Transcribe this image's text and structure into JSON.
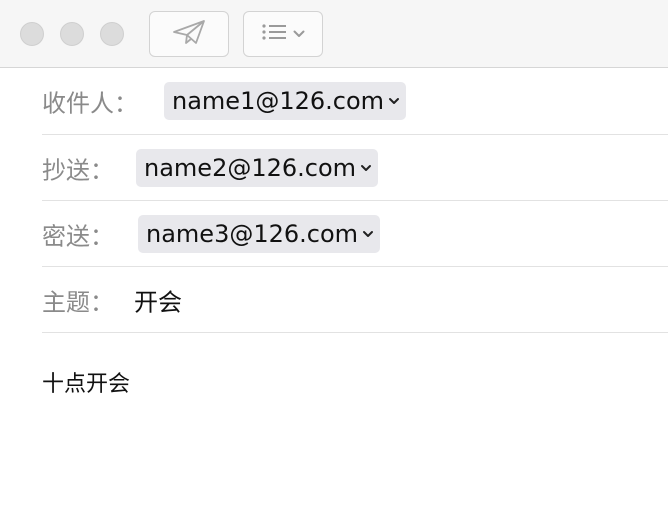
{
  "toolbar": {
    "window_controls": [
      "close",
      "minimize",
      "zoom"
    ],
    "send_icon": "paper-plane-icon",
    "format_icon": "list-icon",
    "format_dropdown_icon": "chevron-down-icon"
  },
  "header": {
    "to": {
      "label": "收件人：",
      "address": "name1@126.com"
    },
    "cc": {
      "label": "抄送：",
      "address": "name2@126.com"
    },
    "bcc": {
      "label": "密送：",
      "address": "name3@126.com"
    },
    "subject": {
      "label": "主题：",
      "value": "开会"
    }
  },
  "body": {
    "text": "十点开会"
  }
}
